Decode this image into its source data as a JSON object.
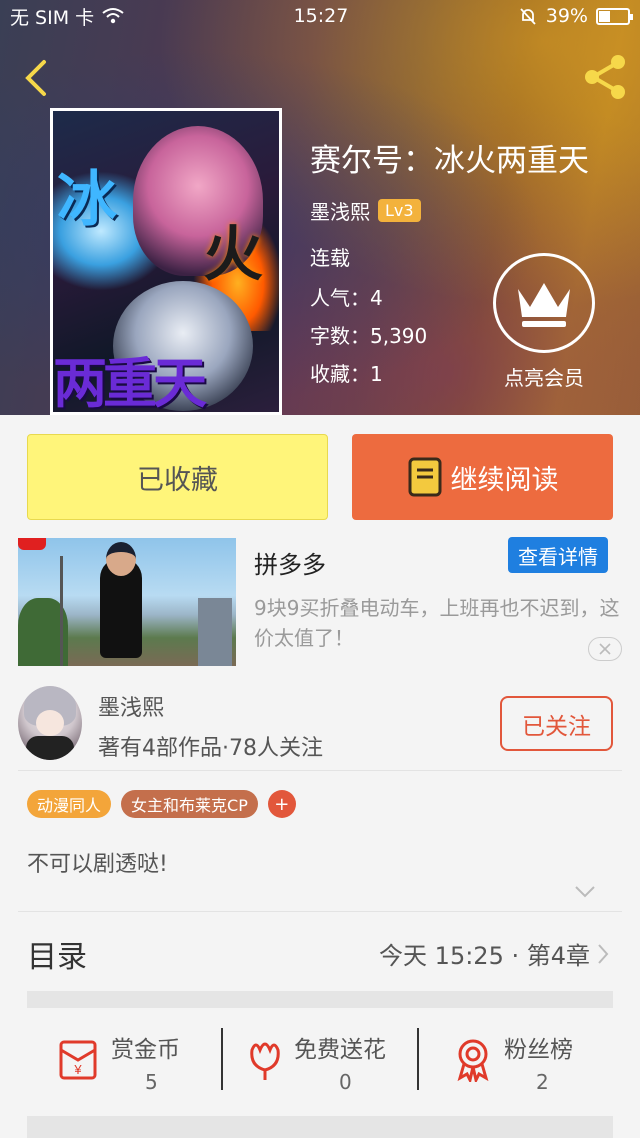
{
  "status_bar": {
    "carrier": "无 SIM 卡",
    "time": "15:27",
    "battery": "39%",
    "battery_level": 0.39
  },
  "book": {
    "title": "赛尔号：冰火两重天",
    "author": "墨浅熙",
    "level": "Lv3",
    "status": "连载",
    "popularity": "人气：4",
    "word_count": "字数：5,390",
    "favorites": "收藏：1",
    "member_label": "点亮会员",
    "cover_text": [
      "冰",
      "火",
      "两重天"
    ]
  },
  "actions": {
    "favorited_label": "已收藏",
    "continue_label": "继续阅读"
  },
  "ad": {
    "title": "拼多多",
    "detail_label": "查看详情",
    "description": "9块9买折叠电动车，上班再也不迟到，这价太值了！"
  },
  "author_card": {
    "name": "墨浅熙",
    "subtitle": "著有4部作品·78人关注",
    "follow_label": "已关注"
  },
  "tags": [
    "动漫同人",
    "女主和布莱克CP"
  ],
  "tag_add": "+",
  "intro": "不可以剧透哒!",
  "toc": {
    "title": "目录",
    "latest": "今天 15:25 · 第4章"
  },
  "stats": [
    {
      "label": "赏金币",
      "value": "5",
      "icon": "red-envelope-yen-icon"
    },
    {
      "label": "免费送花",
      "value": "0",
      "icon": "flower-icon"
    },
    {
      "label": "粉丝榜",
      "value": "2",
      "icon": "award-ribbon-icon"
    }
  ],
  "colors": {
    "accent_orange": "#ed6b3f",
    "fav_yellow": "#fff57a",
    "follow_red": "#e2573b",
    "detail_blue": "#1f7fe0"
  }
}
